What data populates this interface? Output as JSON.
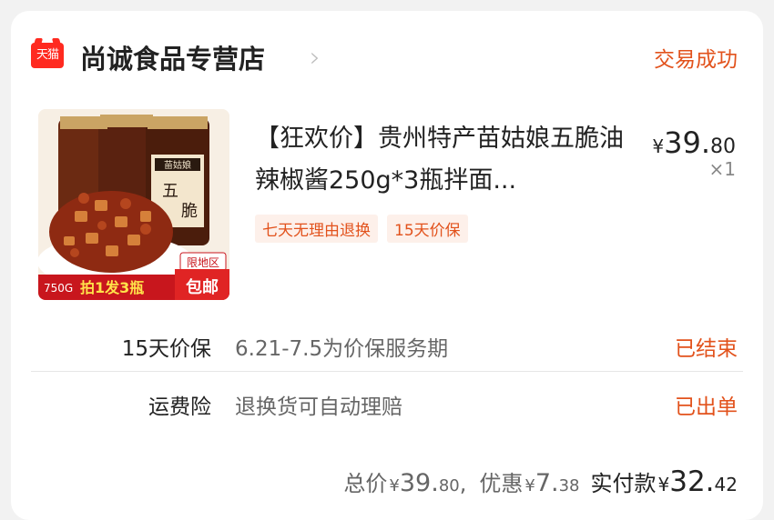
{
  "shop": {
    "logo_text": "天猫",
    "name": "尚诚食品专营店",
    "status": "交易成功"
  },
  "item": {
    "title": "【狂欢价】贵州特产苗姑娘五脆油辣椒酱250g*3瓶拌面...",
    "price_symbol": "¥",
    "price_int": "39.",
    "price_dec": "80",
    "quantity": "×1",
    "tags": [
      "七天无理由退换",
      "15天价保"
    ],
    "image_text": {
      "jar_label": "苗姑娘",
      "jar_text_1": "五",
      "jar_text_2": "脆",
      "region_badge": "限地区",
      "weight": "750G",
      "promo": "拍1发3瓶",
      "shipping": "包邮"
    }
  },
  "services": [
    {
      "label": "15天价保",
      "desc": "6.21-7.5为价保服务期",
      "status": "已结束"
    },
    {
      "label": "运费险",
      "desc": "退换货可自动理赔",
      "status": "已出单"
    }
  ],
  "summary": {
    "total_label": "总价",
    "total_symbol": "¥",
    "total_int": "39.",
    "total_dec": "80",
    "separator": ",",
    "discount_label": "优惠",
    "discount_symbol": "¥",
    "discount_int": "7.",
    "discount_dec": "38",
    "paid_label": "实付款",
    "paid_symbol": "¥",
    "paid_int": "32.",
    "paid_dec": "42"
  },
  "colors": {
    "accent": "#e2521c",
    "tmall_red": "#ff2a20",
    "tag_bg": "#fdf0ea"
  }
}
